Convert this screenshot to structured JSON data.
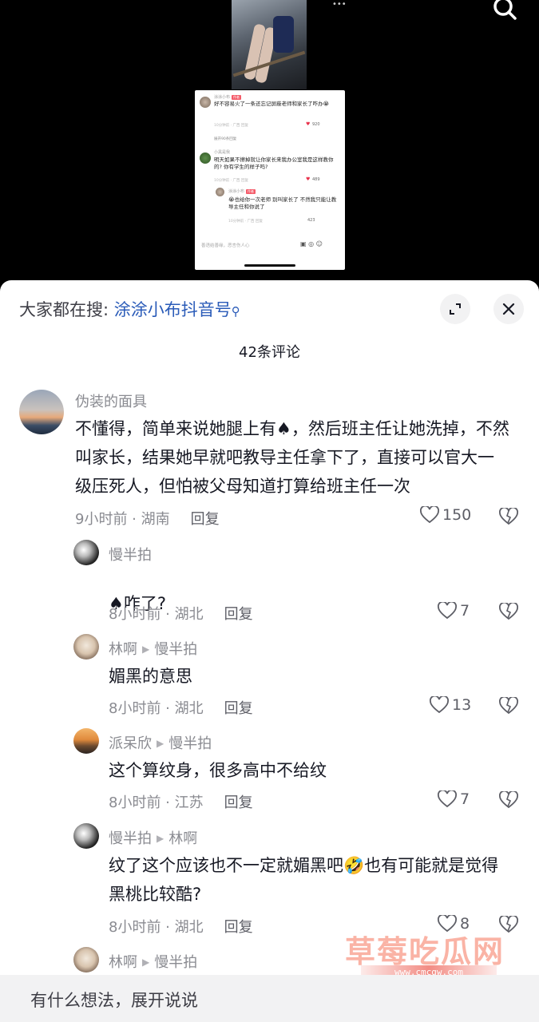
{
  "video": {
    "screenshot": {
      "c1_name": "涂涂小布",
      "c1_tag": "作者",
      "c1_text": "好不容易火了一条还忘记屏蔽老师和家长了咋办😭",
      "c1_meta": "10分钟前  ·  广西   回复",
      "c1_likes": "920",
      "expand": "展开90条回复",
      "c2_name": "小黑是我",
      "c2_text": "明天如果不擦掉就让你家长来我办公室我是这样教你的? 你有学生的样子吗?",
      "c2_meta": "10分钟前  ·  广西   回复",
      "c2_likes": "489",
      "c3_name": "涂涂小布",
      "c3_tag": "作者",
      "c3_text": "😭也给你一次老师 别叫家长了 不然我只能让教导主任和你说了",
      "c3_meta": "10分钟前  ·  广西   回复",
      "c3_likes": "423",
      "input_placeholder": "善语结善缘，恶言伤人心"
    }
  },
  "header": {
    "hot_search_prefix": "大家都在搜: ",
    "hot_search_keyword": "涂涂小布抖音号",
    "comment_count": "42条评论"
  },
  "comments": [
    {
      "user": "伪装的面具",
      "text": "不懂得，简单来说她腿上有♠，然后班主任让她洗掉，不然叫家长，结果她早就吧教导主任拿下了，直接可以官大一级压死人，但怕被父母知道打算给班主任一次",
      "meta": "9小时前 · 湖南",
      "reply_label": "回复",
      "likes": "150"
    },
    {
      "user": "慢半拍",
      "text": "♠咋了?",
      "meta": "8小时前 · 湖北",
      "reply_label": "回复",
      "likes": "7"
    },
    {
      "user": "林啊",
      "reply_to": "慢半拍",
      "text": "媚黑的意思",
      "meta": "8小时前 · 湖北",
      "reply_label": "回复",
      "likes": "13"
    },
    {
      "user": "派呆欣",
      "reply_to": "慢半拍",
      "text": "这个算纹身，很多高中不给纹",
      "meta": "8小时前 · 江苏",
      "reply_label": "回复",
      "likes": "7"
    },
    {
      "user": "慢半拍",
      "reply_to": "林啊",
      "text": "纹了这个应该也不一定就媚黑吧🤣也有可能就是觉得黑桃比较酷?",
      "meta": "8小时前 · 湖北",
      "reply_label": "回复",
      "likes": "8"
    },
    {
      "user": "林啊",
      "reply_to": "慢半拍"
    }
  ],
  "input": {
    "placeholder": "有什么想法，展开说说"
  },
  "watermark": {
    "title": "草莓吃瓜网",
    "url": "www.cmcgw.com"
  }
}
